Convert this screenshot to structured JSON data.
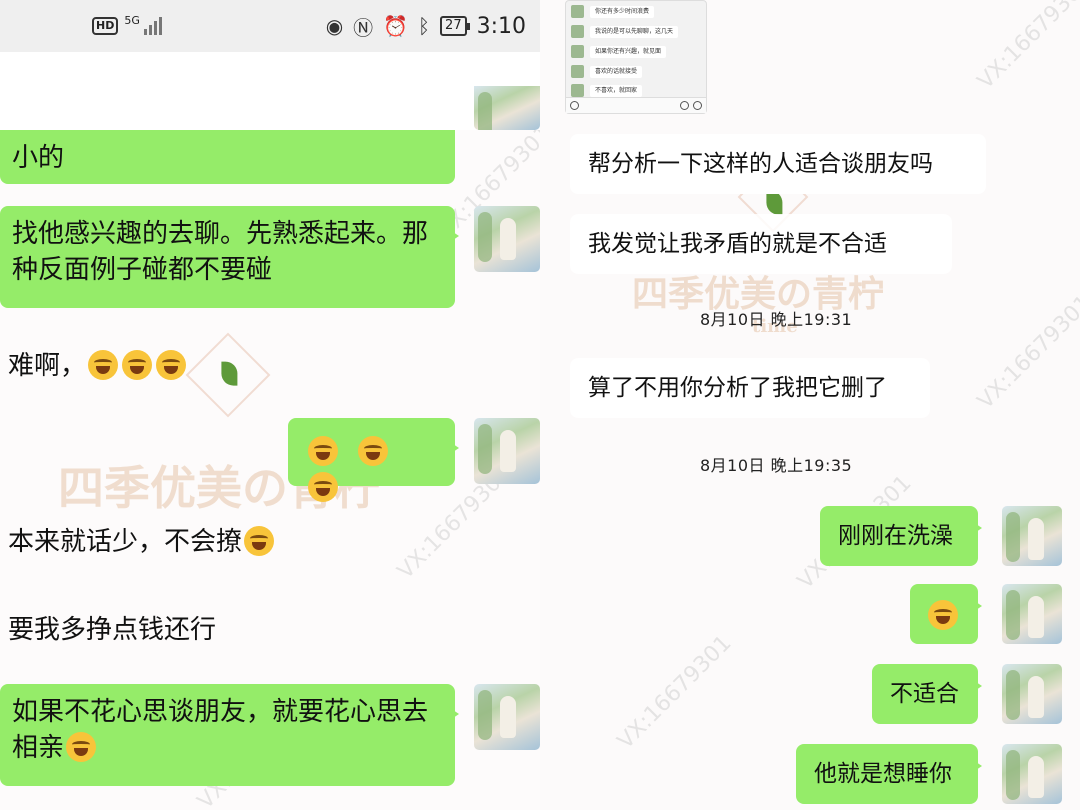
{
  "status_bar": {
    "hd": "HD",
    "network": "5G",
    "battery": "27",
    "time": "3:10"
  },
  "watermark": {
    "text": "四季优美の青柠",
    "sub": "time",
    "vx": "VX:16679301"
  },
  "left_messages": [
    {
      "side": "right",
      "text": "小的"
    },
    {
      "side": "right",
      "text": "找他感兴趣的去聊。先熟悉起来。那种反面例子碰都不要碰"
    },
    {
      "side": "left",
      "text": "难啊，"
    },
    {
      "side": "right",
      "text": ""
    },
    {
      "side": "left",
      "text": "本来就话少，不会撩"
    },
    {
      "side": "left",
      "text": "要我多挣点钱还行"
    },
    {
      "side": "right",
      "text": "如果不花心思谈朋友，就要花心思去相亲"
    }
  ],
  "thumbnail": {
    "rows": [
      "你还有多少时间浪费",
      "我说的是可以先聊聊，这几天",
      "如果你还有兴趣，就见面",
      "喜欢的话就接受",
      "不喜欢，就回家"
    ]
  },
  "right_messages": [
    {
      "side": "left",
      "text": "帮分析一下这样的人适合谈朋友吗"
    },
    {
      "side": "left",
      "text": "我发觉让我矛盾的就是不合适"
    },
    {
      "side": "left",
      "text": "算了不用你分析了我把它删了"
    },
    {
      "side": "right",
      "text": "刚刚在洗澡"
    },
    {
      "side": "right",
      "text": ""
    },
    {
      "side": "right",
      "text": "不适合"
    },
    {
      "side": "right",
      "text": "他就是想睡你"
    }
  ],
  "timestamps": [
    "8月10日 晚上19:31",
    "8月10日 晚上19:35"
  ],
  "emoji": "laugh-cry-emoji"
}
